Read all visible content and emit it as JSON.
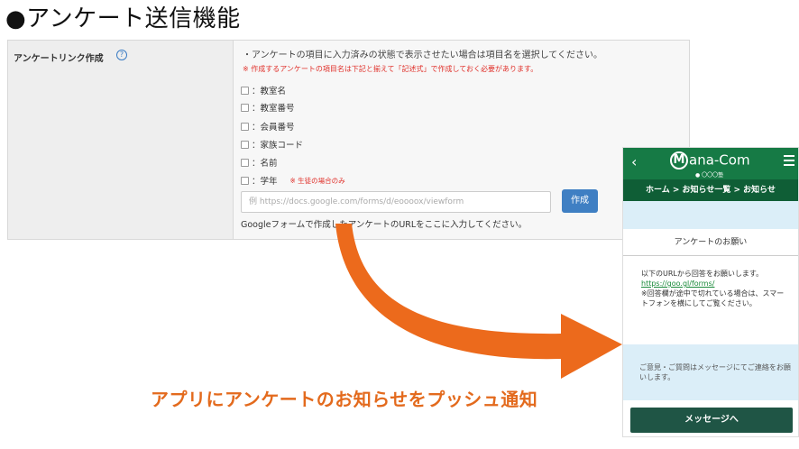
{
  "page_title": "●アンケート送信機能",
  "form": {
    "label": "アンケートリンク作成",
    "help_icon": "?",
    "instruction": "・アンケートの項目に入力済みの状態で表示させたい場合は項目名を選択してください。",
    "note": "※ 作成するアンケートの項目名は下記と揃えて「記述式」で作成しておく必要があります。",
    "checkboxes": [
      {
        "label": "：教室名",
        "note": ""
      },
      {
        "label": "：教室番号",
        "note": ""
      },
      {
        "label": "：会員番号",
        "note": ""
      },
      {
        "label": "：家族コード",
        "note": ""
      },
      {
        "label": "：名前",
        "note": ""
      },
      {
        "label": "：学年",
        "note": "※ 生徒の場合のみ"
      }
    ],
    "url_placeholder": "例  https://docs.google.com/forms/d/eoooox/viewform",
    "create_button": "作成",
    "input_help": "Googleフォームで作成したアンケートのURLをここに入力してください。"
  },
  "caption": "アプリにアンケートのお知らせをプッシュ通知",
  "phone": {
    "back_icon": "‹",
    "logo_m": "M",
    "logo_text": "ana-Com",
    "logo_sub": "● 〇〇〇塾",
    "breadcrumb": "ホーム > お知らせ一覧 > お知らせ",
    "notice_title": "アンケートのお願い",
    "body_line1": "以下のURLから回答をお願いします。",
    "body_link": "https://goo.gl/forms/",
    "body_line2": "※回答欄が途中で切れている場合は、スマートフォンを横にしてご覧ください。",
    "info_text": "ご意見・ご質問はメッセージにてご連絡をお願いします。",
    "message_button": "メッセージへ"
  },
  "colors": {
    "arrow": "#ec6a1c",
    "phone_header": "#167a45",
    "button_blue": "#3f7fc3"
  }
}
